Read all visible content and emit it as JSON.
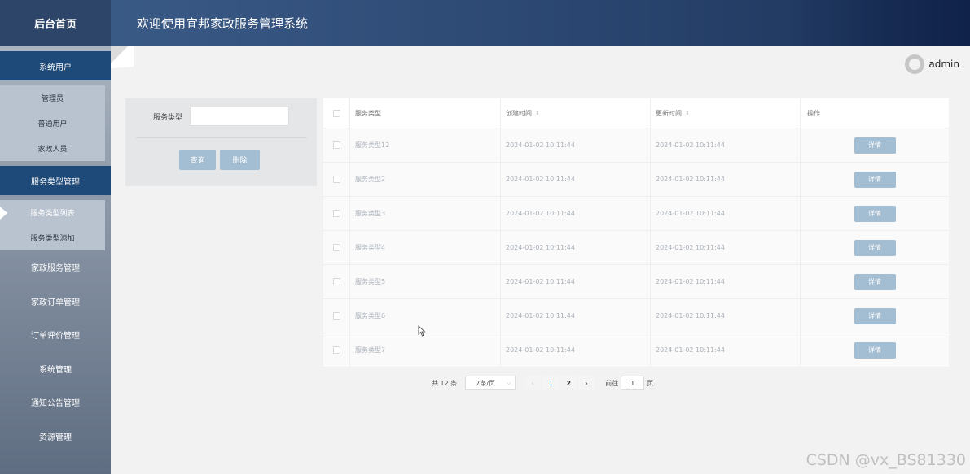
{
  "sidebar": {
    "home": "后台首页",
    "system_users": {
      "label": "系统用户",
      "items": [
        "管理员",
        "普通用户",
        "家政人员"
      ]
    },
    "service_type": {
      "label": "服务类型管理",
      "items": [
        "服务类型列表",
        "服务类型添加"
      ],
      "active_index": 0
    },
    "menu": [
      "家政服务管理",
      "家政订单管理",
      "订单评价管理",
      "系统管理",
      "通知公告管理",
      "资源管理"
    ]
  },
  "header": {
    "title": "欢迎使用宜邦家政服务管理系统"
  },
  "user": {
    "name": "admin"
  },
  "search": {
    "label": "服务类型",
    "value": "",
    "query_label": "查询",
    "delete_label": "删除"
  },
  "table": {
    "columns": [
      "服务类型",
      "创建时间",
      "更新时间",
      "操作"
    ],
    "sort_icon": "⇕",
    "rows": [
      {
        "type": "服务类型12",
        "created": "2024-01-02 10:11:44",
        "updated": "2024-01-02 10:11:44",
        "action": "详情"
      },
      {
        "type": "服务类型2",
        "created": "2024-01-02 10:11:44",
        "updated": "2024-01-02 10:11:44",
        "action": "详情"
      },
      {
        "type": "服务类型3",
        "created": "2024-01-02 10:11:44",
        "updated": "2024-01-02 10:11:44",
        "action": "详情"
      },
      {
        "type": "服务类型4",
        "created": "2024-01-02 10:11:44",
        "updated": "2024-01-02 10:11:44",
        "action": "详情"
      },
      {
        "type": "服务类型5",
        "created": "2024-01-02 10:11:44",
        "updated": "2024-01-02 10:11:44",
        "action": "详情"
      },
      {
        "type": "服务类型6",
        "created": "2024-01-02 10:11:44",
        "updated": "2024-01-02 10:11:44",
        "action": "详情"
      },
      {
        "type": "服务类型7",
        "created": "2024-01-02 10:11:44",
        "updated": "2024-01-02 10:11:44",
        "action": "详情"
      }
    ]
  },
  "pagination": {
    "total": "共 12 条",
    "page_size": "7条/页",
    "prev": "‹",
    "next": "›",
    "pages": [
      "1",
      "2"
    ],
    "goto_prefix": "前往",
    "goto_value": "1",
    "goto_suffix": "页"
  },
  "watermark": "CSDN @vx_BS81330"
}
